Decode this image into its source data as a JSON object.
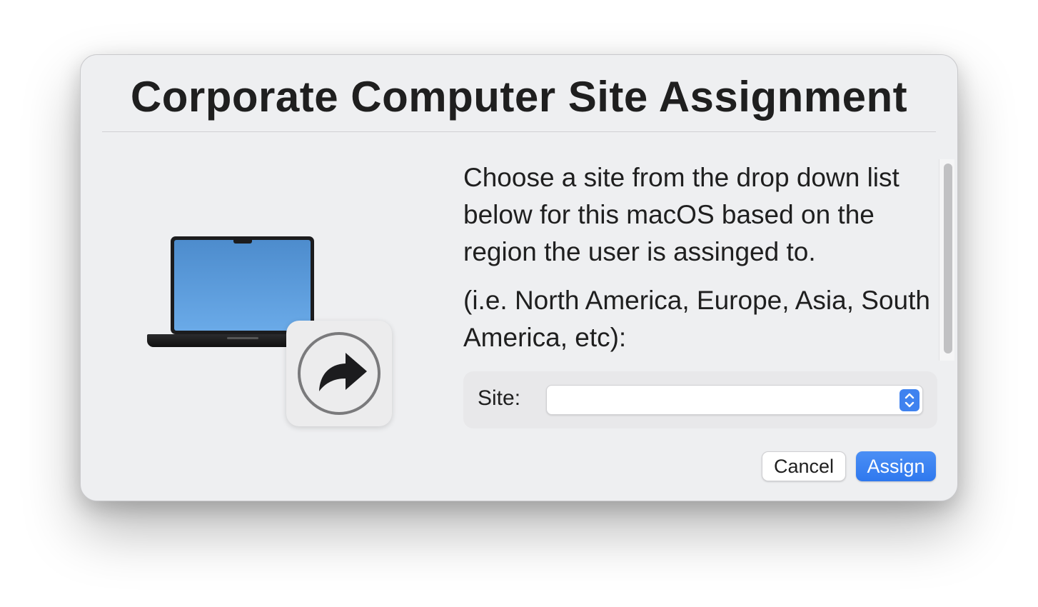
{
  "dialog": {
    "title": "Corporate Computer Site Assignment",
    "message": {
      "paragraph1": "Choose a site from the drop down list below for this macOS based on the region the user is assinged to.",
      "paragraph2": "(i.e. North America, Europe, Asia, South America, etc):"
    },
    "site": {
      "label": "Site:",
      "selected_value": ""
    },
    "buttons": {
      "cancel_label": "Cancel",
      "assign_label": "Assign"
    },
    "icons": {
      "illustration": "laptop-icon",
      "badge": "share-arrow-icon",
      "select_chevron": "up-down-chevron-icon"
    },
    "colors": {
      "accent": "#3f82ef",
      "dialog_background": "#eeeff1"
    }
  }
}
